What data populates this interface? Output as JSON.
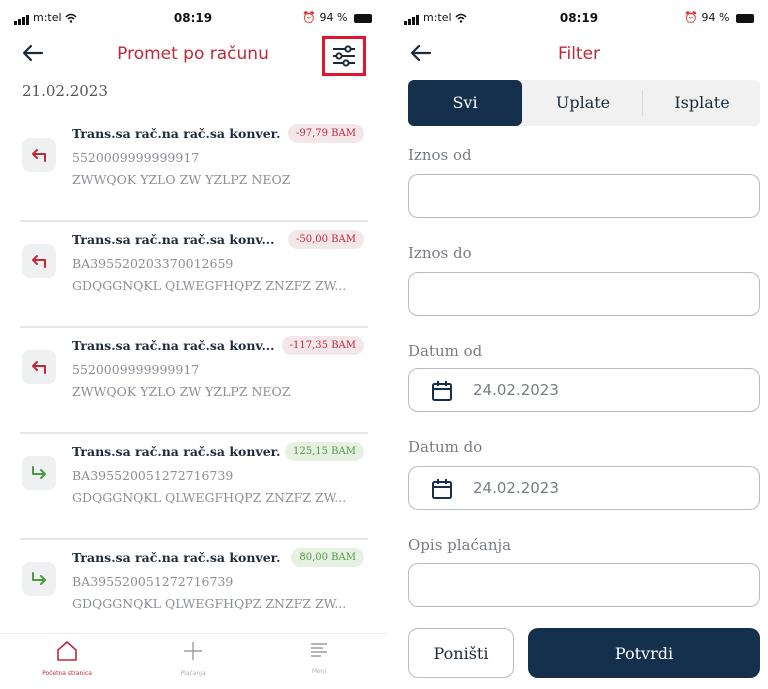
{
  "left": {
    "status": {
      "carrier": "m:tel",
      "time": "08:19",
      "battery": "94 %"
    },
    "title": "Promet po računu",
    "date": "21.02.2023",
    "transactions": [
      {
        "title": "Trans.sa rač.na rač.sa konver.",
        "amount": "-97,79 BAM",
        "type": "out",
        "account": "5520009999999917",
        "name": "ZWWQOK YZLO ZW YZLPZ NEOZ"
      },
      {
        "title": "Trans.sa rač.na rač.sa konv...",
        "amount": "-50,00 BAM",
        "type": "out",
        "account": "BA395520203370012659",
        "name": "GDQGGNQKL QLWEGFHQPZ ZNZFZ ZW..."
      },
      {
        "title": "Trans.sa rač.na rač.sa konv...",
        "amount": "-117,35 BAM",
        "type": "out",
        "account": "5520009999999917",
        "name": "ZWWQOK YZLO ZW YZLPZ NEOZ"
      },
      {
        "title": "Trans.sa rač.na rač.sa konver.",
        "amount": "125,15 BAM",
        "type": "in",
        "account": "BA395520051272716739",
        "name": "GDQGGNQKL QLWEGFHQPZ ZNZFZ ZW..."
      },
      {
        "title": "Trans.sa rač.na rač.sa konver.",
        "amount": "80,00 BAM",
        "type": "in",
        "account": "BA395520051272716739",
        "name": "GDQGGNQKL QLWEGFHQPZ ZNZFZ ZW..."
      }
    ],
    "nav": [
      {
        "label": "Početna stranica",
        "icon": "home-icon"
      },
      {
        "label": "Plaćanja",
        "icon": "plus-icon"
      },
      {
        "label": "Meni",
        "icon": "menu-icon"
      }
    ]
  },
  "right": {
    "status": {
      "carrier": "m:tel",
      "time": "08:19",
      "battery": "94 %"
    },
    "title": "Filter",
    "segments": [
      "Svi",
      "Uplate",
      "Isplate"
    ],
    "active_segment": "Svi",
    "labels": {
      "amount_from": "Iznos od",
      "amount_to": "Iznos do",
      "date_from": "Datum od",
      "date_to": "Datum do",
      "description": "Opis plaćanja"
    },
    "values": {
      "amount_from": "",
      "amount_to": "",
      "date_from": "24.02.2023",
      "date_to": "24.02.2023",
      "description": ""
    },
    "buttons": {
      "cancel": "Poništi",
      "confirm": "Potvrdi"
    }
  },
  "colors": {
    "accent_red": "#c0283a",
    "navy": "#14304d",
    "positive": "#4f9a3f",
    "highlight": "#e3152c"
  }
}
